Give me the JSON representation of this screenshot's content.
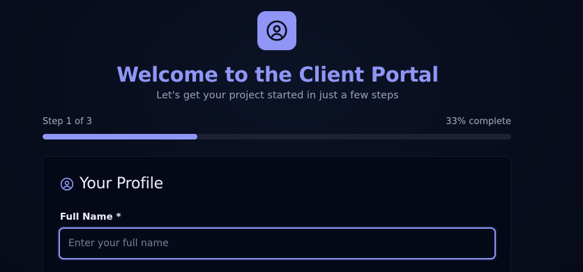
{
  "header": {
    "logo_icon": "user-circle-icon",
    "title": "Welcome to the Client Portal",
    "subtitle": "Let's get your project started in just a few steps"
  },
  "progress": {
    "step_label": "Step 1 of 3",
    "percent_label": "33% complete",
    "percent": 33
  },
  "profile_card": {
    "icon": "user-circle-icon",
    "title": "Your Profile",
    "full_name_label": "Full Name *",
    "full_name_value": "",
    "full_name_placeholder": "Enter your full name"
  },
  "colors": {
    "accent": "#8f96f5",
    "background": "#080d1d",
    "card": "#040817",
    "track": "#1c2233"
  }
}
